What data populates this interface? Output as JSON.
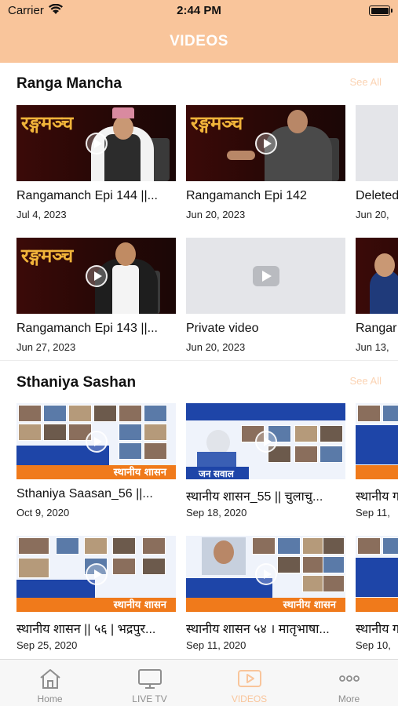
{
  "status_bar": {
    "carrier": "Carrier",
    "time": "2:44 PM"
  },
  "header": {
    "title": "VIDEOS"
  },
  "sections": [
    {
      "title": "Ranga Mancha",
      "see_all": "See All",
      "videos": [
        {
          "title": "Rangamanch Epi  144 ||...",
          "date": "Jul 4, 2023",
          "thumb_text": "रङ्गमञ्च"
        },
        {
          "title": "Rangamanch Epi  142",
          "date": "Jun 20, 2023",
          "thumb_text": "रङ्गमञ्च"
        },
        {
          "title": "Deleted",
          "date": "Jun 20, "
        },
        {
          "title": "Rangamanch Epi  143 ||...",
          "date": "Jun 27, 2023",
          "thumb_text": "रङ्गमञ्च"
        },
        {
          "title": "Private video",
          "date": "Jun 20, 2023"
        },
        {
          "title": "Rangar",
          "date": "Jun 13, "
        }
      ]
    },
    {
      "title": "Sthaniya Sashan",
      "see_all": "See All",
      "videos": [
        {
          "title": "Sthaniya Saasan_56 ||...",
          "date": "Oct 9, 2020",
          "thumb_text": "स्थानीय शासन"
        },
        {
          "title": "स्थानीय शासन_55 ||  चुलाचु...",
          "date": "Sep 18, 2020",
          "thumb_text": "जन सवाल"
        },
        {
          "title": "स्थानीय ग",
          "date": "Sep 11, "
        },
        {
          "title": "स्थानीय शासन || ५६ | भद्रपुर...",
          "date": "Sep 25, 2020",
          "thumb_text": "स्थानीय शासन"
        },
        {
          "title": "स्थानीय शासन ५४ । मातृभाषा...",
          "date": "Sep 11, 2020",
          "thumb_text": "स्थानीय शासन"
        },
        {
          "title": "स्थानीय ग",
          "date": "Sep 10, "
        }
      ]
    }
  ],
  "tab_bar": {
    "tabs": [
      {
        "label": "Home",
        "icon": "home-icon"
      },
      {
        "label": "LIVE TV",
        "icon": "tv-icon"
      },
      {
        "label": "VIDEOS",
        "icon": "video-icon",
        "active": true
      },
      {
        "label": "More",
        "icon": "more-icon"
      }
    ]
  },
  "colors": {
    "header_bg": "#f9c59b",
    "accent": "#f9c59b",
    "see_all": "#fbd3b3"
  }
}
